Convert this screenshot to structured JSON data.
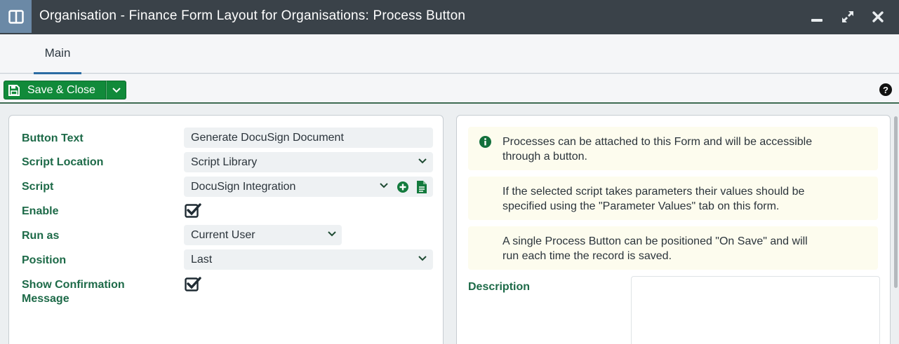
{
  "window": {
    "title": "Organisation - Finance Form Layout for Organisations: Process Button",
    "toggle_icon": "panel-layout-icon",
    "controls": [
      "minimize-icon",
      "maximize-icon",
      "close-icon"
    ]
  },
  "tabs": [
    {
      "label": "Main",
      "active": true
    }
  ],
  "toolbar": {
    "save_label": "Save & Close",
    "save_icon": "floppy-disk-icon",
    "help_label": "?",
    "accent_color": "#118a3a"
  },
  "form": {
    "button_text": {
      "label": "Button Text",
      "value": "Generate DocuSign Document"
    },
    "script_location": {
      "label": "Script Location",
      "value": "Script Library"
    },
    "script": {
      "label": "Script",
      "value": "DocuSign Integration"
    },
    "enable": {
      "label": "Enable",
      "checked": true
    },
    "run_as": {
      "label": "Run as",
      "value": "Current User"
    },
    "position": {
      "label": "Position",
      "value": "Last"
    },
    "show_confirmation": {
      "label_line1": "Show Confirmation",
      "label_line2": "Message",
      "checked": true
    }
  },
  "info": {
    "note1_line1": "Processes can be attached to this Form and will be accessible",
    "note1_line2": "through a button.",
    "note2_line1": "If the selected script takes parameters their values should be",
    "note2_line2": "specified using the \"Parameter Values\" tab on this form.",
    "note3_line1": "A single Process Button can be positioned \"On Save\" and will",
    "note3_line2": "run each time the record is saved.",
    "description_label": "Description",
    "description_value": ""
  },
  "colors": {
    "title_bar": "#3a4249",
    "label_green": "#1d6a48",
    "note_bg": "#fdfcee",
    "field_bg": "#eef1f3"
  }
}
